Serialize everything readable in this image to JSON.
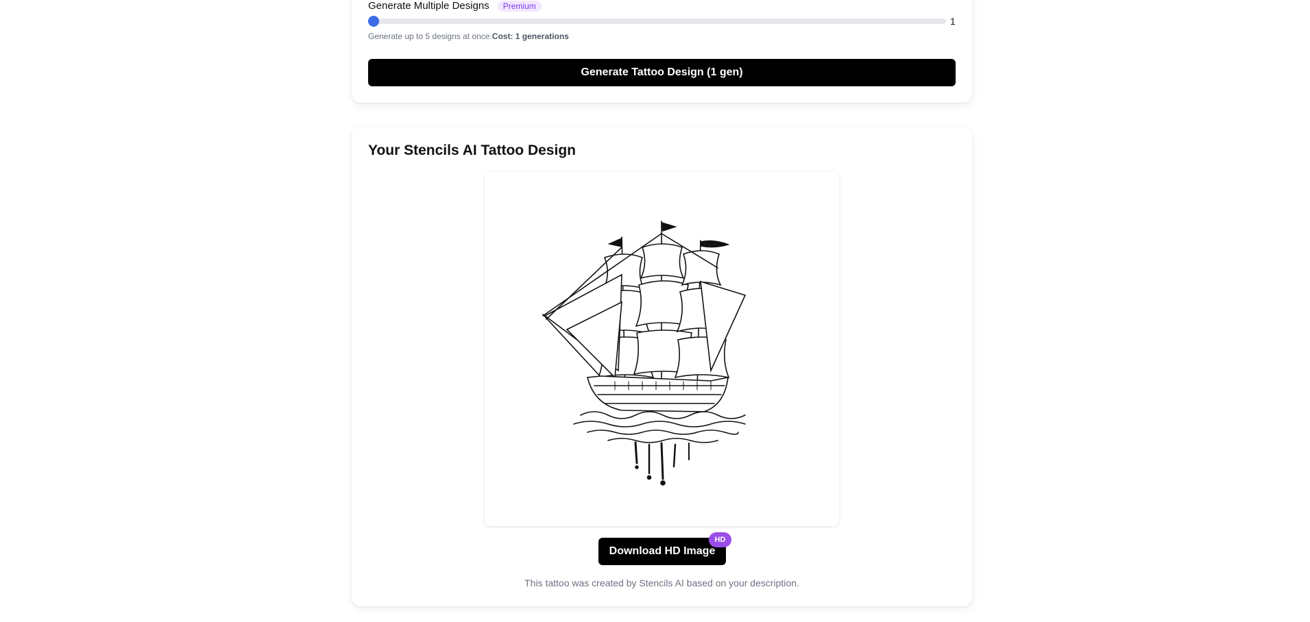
{
  "generator": {
    "multi_label": "Generate Multiple Designs",
    "premium_badge": "Premium",
    "slider_value": "1",
    "slider_fraction": 0.0,
    "helper_text": "Generate up to 5 designs at once.",
    "helper_cost": "Cost: 1 generations",
    "generate_button": "Generate Tattoo Design (1 gen)"
  },
  "result": {
    "title": "Your Stencils AI Tattoo Design",
    "download_button": "Download HD Image",
    "hd_badge": "HD",
    "caption": "This tattoo was created by Stencils AI based on your description."
  },
  "colors": {
    "accent": "#3b6be8",
    "button": "#000000",
    "badge_purple": "#9b4dea"
  },
  "icons": [
    "slider-thumb",
    "ship-tattoo-image"
  ]
}
